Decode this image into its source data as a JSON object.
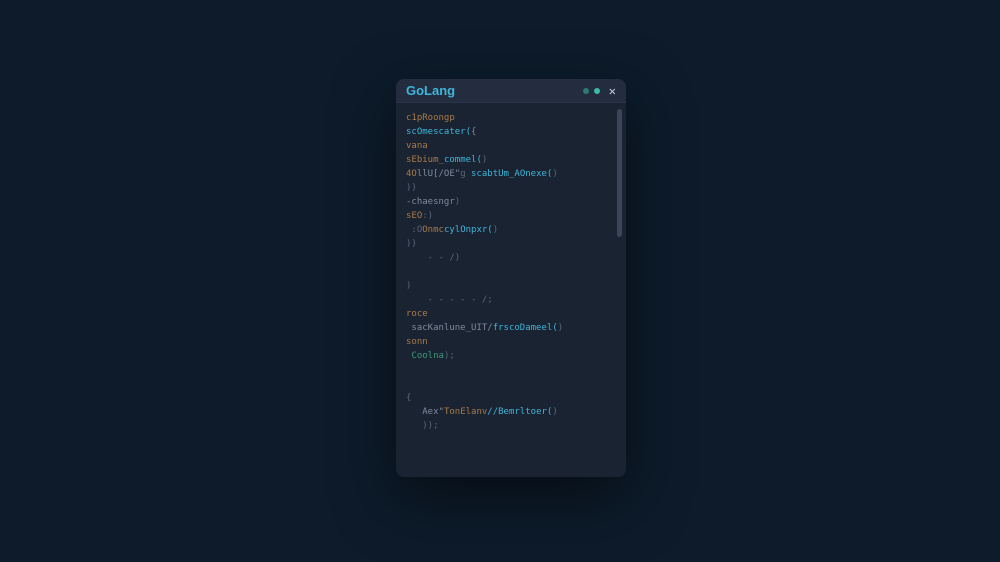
{
  "window": {
    "title": "GoLang"
  },
  "code": {
    "lines": [
      {
        "tokens": [
          {
            "t": "c1pRoongp",
            "c": "tok-kw"
          }
        ]
      },
      {
        "tokens": [
          {
            "t": "scOmescater(",
            "c": "tok-fn"
          },
          {
            "t": "{",
            "c": "tok-id"
          }
        ]
      },
      {
        "tokens": [
          {
            "t": "vana",
            "c": "tok-kw"
          }
        ]
      },
      {
        "tokens": [
          {
            "t": "sEbium_",
            "c": "tok-kw"
          },
          {
            "t": "commel(",
            "c": "tok-fn"
          },
          {
            "t": ")",
            "c": "tok-punc"
          }
        ]
      },
      {
        "tokens": [
          {
            "t": "4O",
            "c": "tok-kw"
          },
          {
            "t": "llU[/OE\"",
            "c": "tok-id"
          },
          {
            "t": "g ",
            "c": "tok-punc"
          },
          {
            "t": "scabtUm_AOnexe(",
            "c": "tok-fn"
          },
          {
            "t": ")",
            "c": "tok-punc"
          }
        ]
      },
      {
        "tokens": [
          {
            "t": "))",
            "c": "tok-punc"
          }
        ]
      },
      {
        "tokens": [
          {
            "t": "-chaesngr",
            "c": "tok-id"
          },
          {
            "t": ")",
            "c": "tok-punc"
          }
        ]
      },
      {
        "tokens": [
          {
            "t": "sEO",
            "c": "tok-kw"
          },
          {
            "t": ":)",
            "c": "tok-punc"
          }
        ]
      },
      {
        "tokens": [
          {
            "t": " :O",
            "c": "tok-punc"
          },
          {
            "t": "Onmc",
            "c": "tok-kw"
          },
          {
            "t": "cylOnpxr(",
            "c": "tok-fn"
          },
          {
            "t": ")",
            "c": "tok-punc"
          }
        ]
      },
      {
        "tokens": [
          {
            "t": "))",
            "c": "tok-punc"
          }
        ]
      },
      {
        "tokens": [
          {
            "t": "    - - /)",
            "c": "tok-punc"
          }
        ]
      },
      {
        "tokens": [
          {
            "t": "",
            "c": ""
          }
        ]
      },
      {
        "tokens": [
          {
            "t": ")",
            "c": "tok-punc"
          }
        ]
      },
      {
        "tokens": [
          {
            "t": "    - - - - - /;",
            "c": "tok-punc"
          }
        ]
      },
      {
        "tokens": [
          {
            "t": "roce",
            "c": "tok-kw"
          }
        ]
      },
      {
        "tokens": [
          {
            "t": " sacKanlune_UIT/",
            "c": "tok-id"
          },
          {
            "t": "frscoDameel(",
            "c": "tok-fn"
          },
          {
            "t": ")",
            "c": "tok-punc"
          }
        ]
      },
      {
        "tokens": [
          {
            "t": "sonn",
            "c": "tok-kw"
          }
        ]
      },
      {
        "tokens": [
          {
            "t": " Coolna",
            "c": "tok-str"
          },
          {
            "t": ");",
            "c": "tok-punc"
          }
        ]
      },
      {
        "tokens": [
          {
            "t": "",
            "c": ""
          }
        ]
      },
      {
        "tokens": [
          {
            "t": "",
            "c": ""
          }
        ]
      },
      {
        "tokens": [
          {
            "t": "{",
            "c": "tok-punc"
          }
        ]
      },
      {
        "tokens": [
          {
            "t": "   Aex\"",
            "c": "tok-id"
          },
          {
            "t": "TonElanv",
            "c": "tok-kw"
          },
          {
            "t": "//Bemrltoer(",
            "c": "tok-fn"
          },
          {
            "t": ")",
            "c": "tok-punc"
          }
        ]
      },
      {
        "tokens": [
          {
            "t": "   ));",
            "c": "tok-punc"
          }
        ]
      }
    ]
  }
}
